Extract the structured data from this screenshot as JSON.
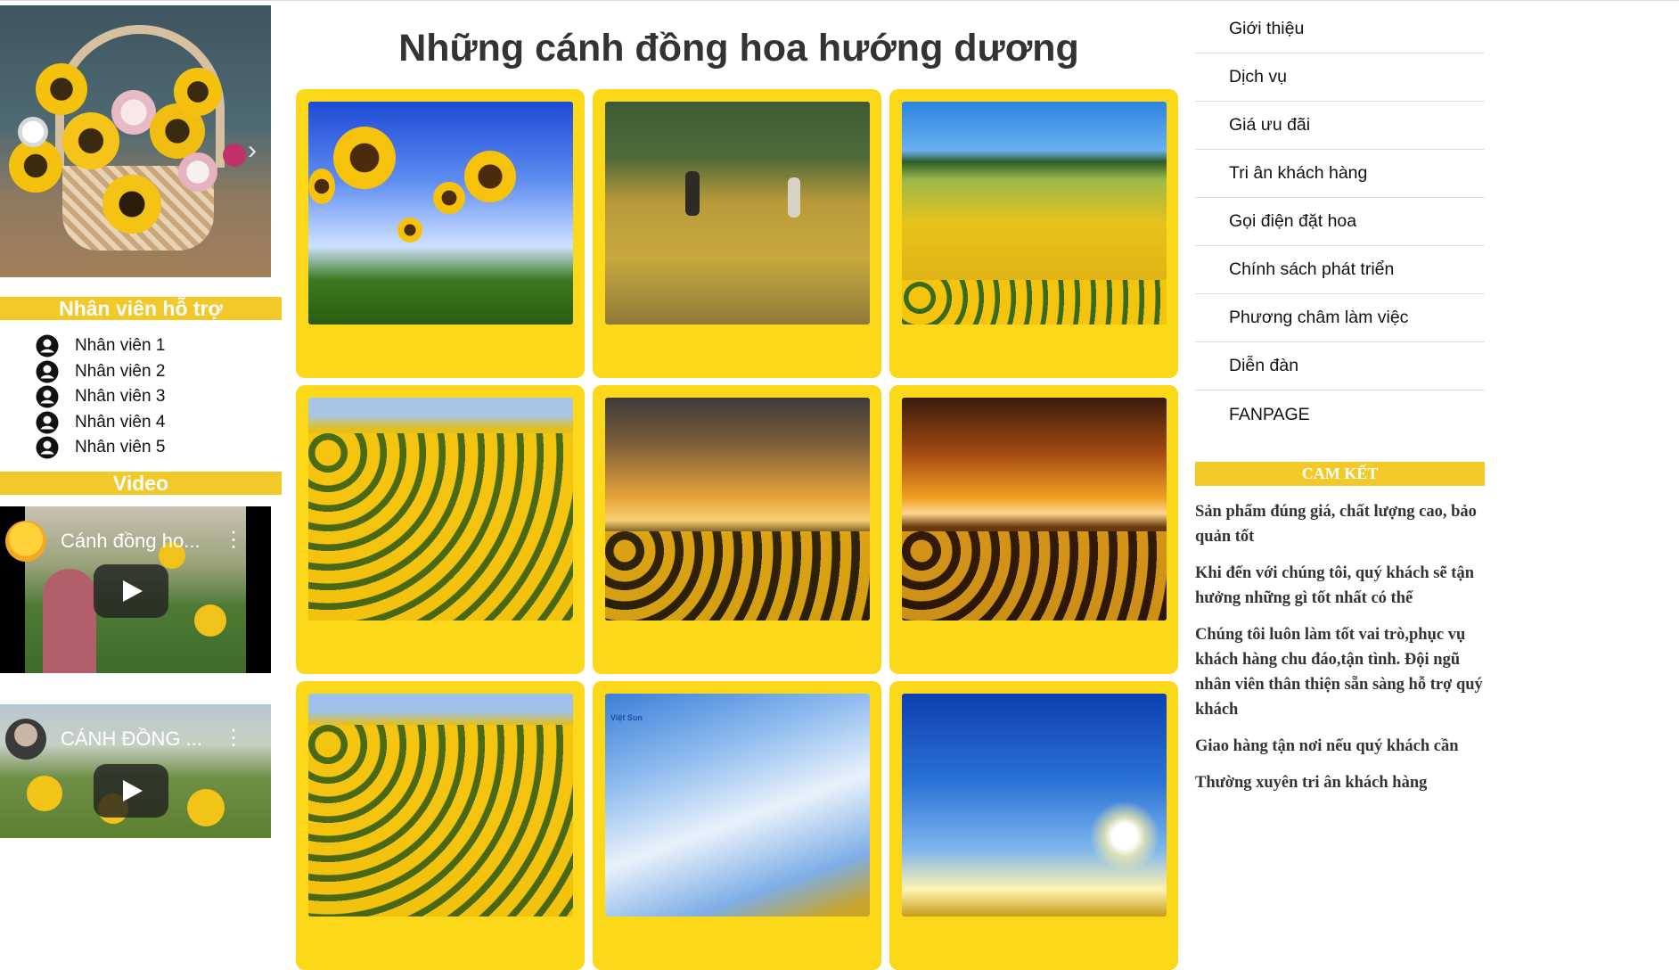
{
  "slider": {
    "image_alt": "Giỏ hoa hướng dương",
    "next_icon": "chevron-right-icon",
    "next_glyph": "›"
  },
  "staff_section": {
    "title": "Nhân viên hỗ trợ",
    "items": [
      {
        "label": "Nhân viên 1",
        "icon": "user-circle-icon"
      },
      {
        "label": "Nhân viên 2",
        "icon": "user-circle-icon"
      },
      {
        "label": "Nhân viên 3",
        "icon": "user-circle-icon"
      },
      {
        "label": "Nhân viên 4",
        "icon": "user-circle-icon"
      },
      {
        "label": "Nhân viên 5",
        "icon": "user-circle-icon"
      }
    ]
  },
  "video_section": {
    "title": "Video",
    "videos": [
      {
        "title": "Cánh đồng ho...",
        "menu_glyph": "⋮",
        "play_icon": "play-icon"
      },
      {
        "title": "CÁNH ĐỒNG ...",
        "menu_glyph": "⋮",
        "play_icon": "play-icon"
      }
    ]
  },
  "main": {
    "title": "Những cánh đồng hoa hướng dương",
    "gallery": [
      {
        "alt": "Hoa hướng dương dưới trời xanh"
      },
      {
        "alt": "Đôi bạn trên cánh đồng hoa"
      },
      {
        "alt": "Đồi hoa hướng dương"
      },
      {
        "alt": "Cánh đồng hoa hướng dương"
      },
      {
        "alt": "Hoàng hôn trên cánh đồng hoa"
      },
      {
        "alt": "Cánh đồng hoa lúc chiều tà"
      },
      {
        "alt": "Cánh đồng hoa hướng dương"
      },
      {
        "alt": "Bầu trời mây trắng",
        "watermark": "Việt Sun"
      },
      {
        "alt": "Bình minh xanh"
      }
    ]
  },
  "nav_menu": {
    "items": [
      "Giới thiệu",
      "Dịch vụ",
      "Giá ưu đãi",
      "Tri ân khách hàng",
      "Gọi điện đặt hoa",
      "Chính sách phát triển",
      "Phương châm làm việc",
      "Diễn đàn",
      "FANPAGE"
    ]
  },
  "commitment": {
    "title": "CAM KẾT",
    "items": [
      "Sản phẩm đúng giá, chất lượng cao, bảo quản tốt",
      "Khi đến với chúng tôi, quý khách sẽ tận hưởng những gì tốt nhất có thể",
      "Chúng tôi luôn làm tốt vai trò,phục vụ khách hàng chu đáo,tận tình. Đội ngũ nhân viên thân thiện sẵn sàng hỗ trợ quý khách",
      "Giao hàng tận nơi nếu quý khách cần",
      "Thường xuyên tri ân khách hàng"
    ]
  },
  "colors": {
    "accent_yellow": "#f3c92a",
    "card_yellow": "#fcd81b"
  }
}
